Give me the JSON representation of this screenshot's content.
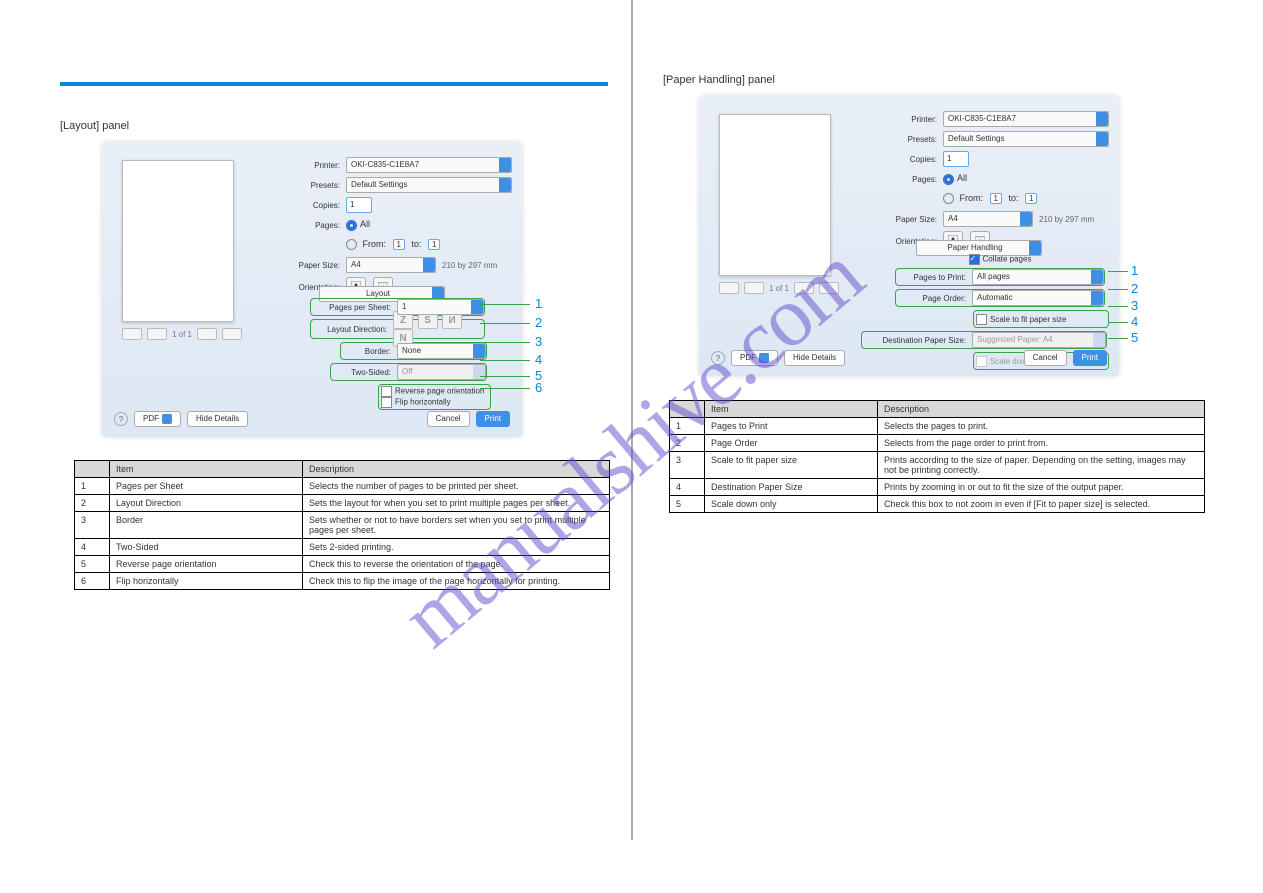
{
  "watermark": "manualshive.com",
  "left": {
    "section_heading": "[Layout] panel",
    "dialog": {
      "printer_label": "Printer:",
      "printer_value": "OKI-C835-C1E8A7",
      "presets_label": "Presets:",
      "presets_value": "Default Settings",
      "copies_label": "Copies:",
      "copies_value": "1",
      "pages_label": "Pages:",
      "pages_all": "All",
      "pages_from_label": "From:",
      "pages_from_value": "1",
      "pages_to_label": "to:",
      "pages_to_value": "1",
      "paper_size_label": "Paper Size:",
      "paper_size_value": "A4",
      "paper_size_dim": "210 by 297 mm",
      "orientation_label": "Orientation:",
      "panel_select": "Layout",
      "pps_label": "Pages per Sheet:",
      "pps_value": "1",
      "dir_label": "Layout Direction:",
      "border_label": "Border:",
      "border_value": "None",
      "twosided_label": "Two-Sided:",
      "twosided_value": "Off",
      "reverse_label": "Reverse page orientation",
      "flip_label": "Flip horizontally",
      "preview_page": "1 of 1",
      "help": "?",
      "pdf": "PDF",
      "hide_details": "Hide Details",
      "cancel": "Cancel",
      "print": "Print"
    },
    "table": {
      "headers": [
        "",
        "Item",
        "Description"
      ],
      "rows": [
        [
          "1",
          "Pages per Sheet",
          "Selects the number of pages to be printed per sheet."
        ],
        [
          "2",
          "Layout Direction",
          "Sets the layout for when you set to print multiple pages per sheet."
        ],
        [
          "3",
          "Border",
          "Sets whether or not to have borders set when you set to print multiple pages per sheet."
        ],
        [
          "4",
          "Two-Sided",
          "Sets 2-sided printing."
        ],
        [
          "5",
          "Reverse page orientation",
          "Check this to reverse the orientation of the page."
        ],
        [
          "6",
          "Flip horizontally",
          "Check this to flip the image of the page horizontally for printing."
        ]
      ]
    }
  },
  "right": {
    "section_heading": "[Paper Handling] panel",
    "dialog": {
      "printer_label": "Printer:",
      "printer_value": "OKI-C835-C1E8A7",
      "presets_label": "Presets:",
      "presets_value": "Default Settings",
      "copies_label": "Copies:",
      "copies_value": "1",
      "pages_label": "Pages:",
      "pages_all": "All",
      "pages_from_label": "From:",
      "pages_from_value": "1",
      "pages_to_label": "to:",
      "pages_to_value": "1",
      "paper_size_label": "Paper Size:",
      "paper_size_value": "A4",
      "paper_size_dim": "210 by 297 mm",
      "orientation_label": "Orientation:",
      "panel_select": "Paper Handling",
      "collate_label": "Collate pages",
      "ptp_label": "Pages to Print:",
      "ptp_value": "All pages",
      "order_label": "Page Order:",
      "order_value": "Automatic",
      "scale_label": "Scale to fit paper size",
      "dest_label": "Destination Paper Size:",
      "dest_value": "Suggested Paper: A4",
      "scale_down_label": "Scale down only",
      "preview_page": "1 of 1",
      "help": "?",
      "pdf": "PDF",
      "hide_details": "Hide Details",
      "cancel": "Cancel",
      "print": "Print"
    },
    "table": {
      "headers": [
        "",
        "Item",
        "Description"
      ],
      "rows": [
        [
          "1",
          "Pages to Print",
          "Selects the pages to print."
        ],
        [
          "2",
          "Page Order",
          "Selects from the page order to print from."
        ],
        [
          "3",
          "Scale to fit paper size",
          "Prints according to the size of paper. Depending on the setting, images may not be printing correctly."
        ],
        [
          "4",
          "Destination Paper Size",
          "Prints by zooming in or out to fit the size of the output paper."
        ],
        [
          "5",
          "Scale down only",
          "Check this box to not zoom in even if [Fit to paper size] is selected."
        ]
      ]
    }
  }
}
